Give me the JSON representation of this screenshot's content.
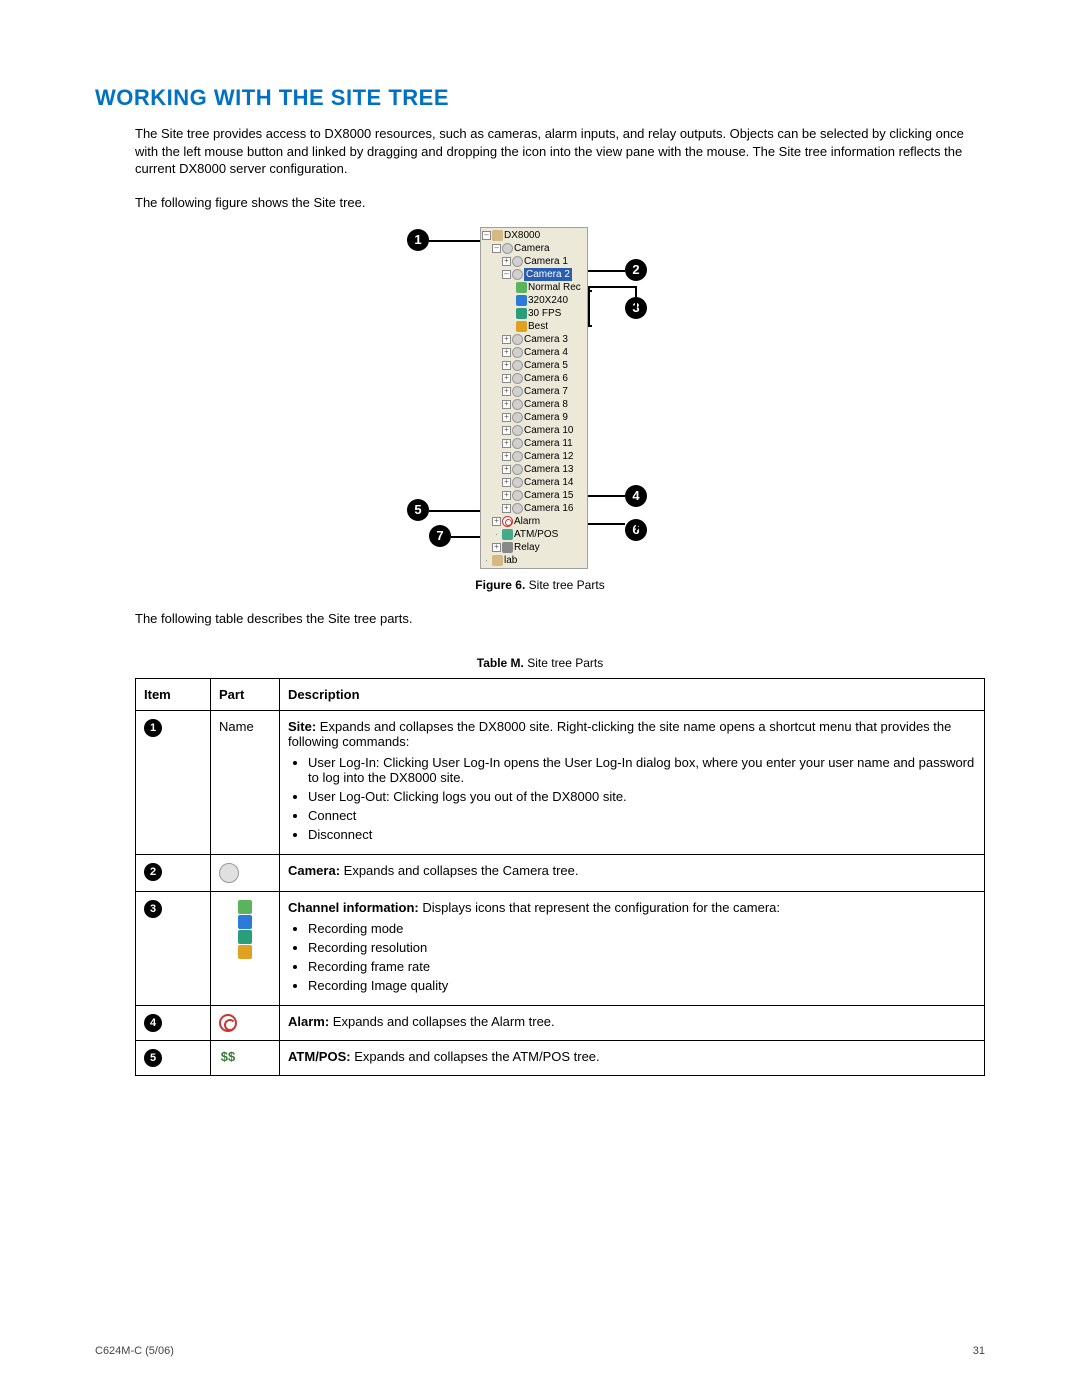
{
  "heading": "WORKING WITH THE SITE TREE",
  "intro_para": "The Site tree provides access to DX8000 resources, such as cameras, alarm inputs, and relay outputs. Objects can be selected by clicking once with the left mouse button and linked by dragging and dropping the icon into the view pane with the mouse. The Site tree information reflects the current DX8000 server configuration.",
  "intro_para2": "The following figure shows the Site tree.",
  "figure": {
    "label": "Figure 6.",
    "caption": "Site tree Parts"
  },
  "after_figure_para": "The following table describes the Site tree parts.",
  "table_caption_label": "Table M.",
  "table_caption_text": "Site tree Parts",
  "tree": {
    "root": "DX8000",
    "camera_group": "Camera",
    "cameras": [
      "Camera 1",
      "Camera 2",
      "Camera 3",
      "Camera 4",
      "Camera 5",
      "Camera 6",
      "Camera 7",
      "Camera 8",
      "Camera 9",
      "Camera 10",
      "Camera 11",
      "Camera 12",
      "Camera 13",
      "Camera 14",
      "Camera 15",
      "Camera 16"
    ],
    "selected_camera": "Camera 2",
    "cam2_children": [
      "Normal Rec",
      "320X240",
      "30 FPS",
      "Best"
    ],
    "alarm": "Alarm",
    "atmpos": "ATM/POS",
    "relay": "Relay",
    "lab": "lab"
  },
  "callouts": {
    "1": "1",
    "2": "2",
    "3": "3",
    "4": "4",
    "5": "5",
    "6": "6",
    "7": "7"
  },
  "table": {
    "headers": {
      "item": "Item",
      "part": "Part",
      "desc": "Description"
    },
    "rows": [
      {
        "num": "1",
        "part_text": "Name",
        "desc_lead_bold": "Site:",
        "desc_lead_rest": " Expands and collapses the DX8000 site. Right-clicking the site name opens a shortcut menu that provides the following commands:",
        "bullets": [
          "User Log-In: Clicking User Log-In opens the User Log-In dialog box, where you enter your user name and password to log into the DX8000 site.",
          "User Log-Out: Clicking logs you out of the DX8000 site.",
          "Connect",
          "Disconnect"
        ]
      },
      {
        "num": "2",
        "icon_kind": "cam",
        "desc_lead_bold": "Camera:",
        "desc_lead_rest": " Expands and collapses the Camera tree."
      },
      {
        "num": "3",
        "icon_kind": "stack",
        "desc_lead_bold": "Channel information:",
        "desc_lead_rest": " Displays icons that represent the configuration for the camera:",
        "bullets": [
          "Recording mode",
          "Recording resolution",
          "Recording frame rate",
          "Recording Image quality"
        ]
      },
      {
        "num": "4",
        "icon_kind": "alarm",
        "desc_lead_bold": "Alarm:",
        "desc_lead_rest": " Expands and collapses the Alarm tree."
      },
      {
        "num": "5",
        "icon_kind": "atm",
        "desc_lead_bold": "ATM/POS:",
        "desc_lead_rest": " Expands and collapses the ATM/POS tree."
      }
    ]
  },
  "footer_left": "C624M-C (5/06)",
  "footer_right": "31"
}
